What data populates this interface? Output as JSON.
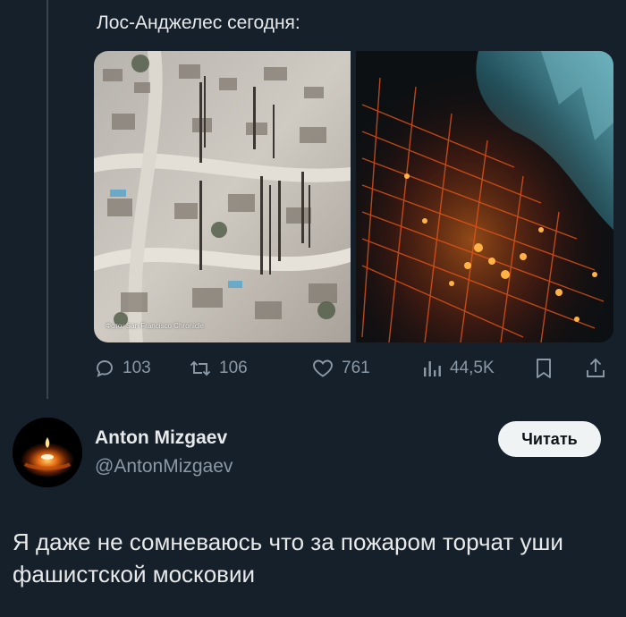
{
  "quoted_tweet": {
    "text": "Лос-Анджелес сегодня:",
    "photo_credit": "Фото: San Francisco Chronicle",
    "stats": {
      "replies": "103",
      "retweets": "106",
      "likes": "761",
      "views": "44,5K"
    },
    "icons": {
      "reply": "reply-icon",
      "retweet": "retweet-icon",
      "like": "heart-icon",
      "views": "views-icon",
      "bookmark": "bookmark-icon",
      "share": "share-icon"
    }
  },
  "reply_tweet": {
    "display_name": "Anton Mizgaev",
    "handle": "@AntonMizgaev",
    "follow_label": "Читать",
    "text": "Я даже не сомневаюсь что за пожаром торчат уши фашистской московии"
  },
  "colors": {
    "background": "#15202b",
    "primary_text": "#e7e9ea",
    "secondary_text": "#8b98a5",
    "button_bg": "#eff3f4",
    "thread_line": "#38444d"
  }
}
